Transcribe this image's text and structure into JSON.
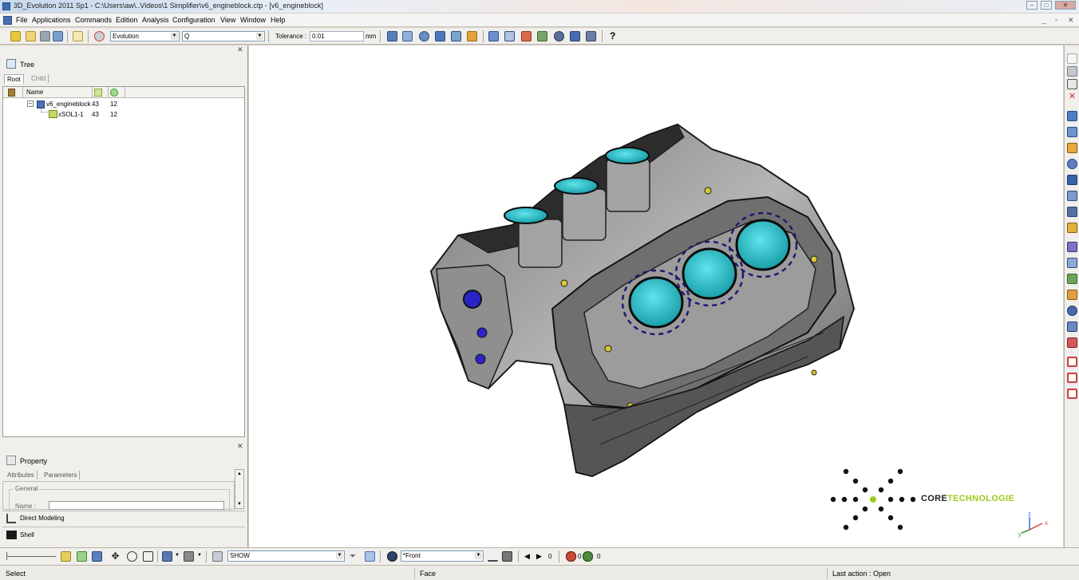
{
  "titlebar": {
    "title": "3D_Evolution 2011 Sp1 - C:\\Users\\aw\\..Videos\\1 Simplifier\\v6_engineblock.ctp - [v6_engineblock]"
  },
  "menu": {
    "items": [
      "File",
      "Applications",
      "Commands",
      "Edition",
      "Analysis",
      "Configuration",
      "View",
      "Window",
      "Help"
    ]
  },
  "toolbar": {
    "mode_value": "Evolution",
    "search_value": "Q",
    "tolerance_label": "Tolerance :",
    "tolerance_value": "0.01",
    "tolerance_unit": "mm",
    "help_label": "?"
  },
  "tree_panel": {
    "title": "Tree",
    "tabs": [
      "Root",
      "Child"
    ],
    "columns": {
      "name": "Name"
    },
    "rows": [
      {
        "name": "v6_engineblock",
        "a": "43",
        "b": "12"
      },
      {
        "name": "xSOL1-1",
        "a": "43",
        "b": "12"
      }
    ]
  },
  "property_panel": {
    "title": "Property",
    "tabs": [
      "Attributes",
      "Parameters"
    ],
    "group": "General",
    "name_label": "Name :",
    "name_value": ""
  },
  "modes": {
    "direct_modeling": "Direct Modeling",
    "shell": "Shell"
  },
  "bottom_toolbar": {
    "show_value": "SHOW",
    "view_value": "*Front",
    "counter1": "0",
    "counter2": "0",
    "counter3": "0"
  },
  "status": {
    "left": "Select",
    "middle": "Face",
    "right": "Last action : Open"
  },
  "logo": {
    "word_a": "CORE",
    "word_b": "TECHNOLOGIE",
    "color_a": "#222222",
    "color_b": "#9ccc1c"
  },
  "axes": {
    "x": "x",
    "y": "y",
    "z": "z"
  }
}
